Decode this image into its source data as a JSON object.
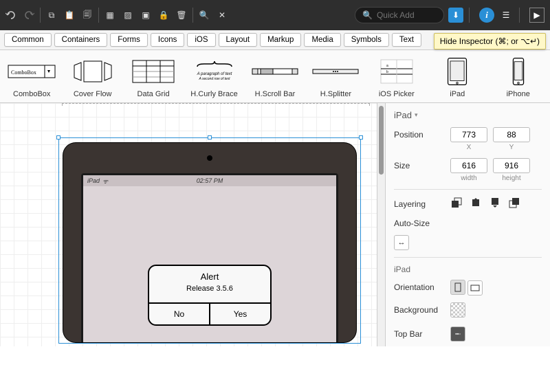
{
  "toolbar": {
    "search_placeholder": "Quick Add"
  },
  "tabs": [
    "Common",
    "Containers",
    "Forms",
    "Icons",
    "iOS",
    "Layout",
    "Markup",
    "Media",
    "Symbols",
    "Text"
  ],
  "shelf": [
    {
      "label": "ComboBox"
    },
    {
      "label": "Cover Flow"
    },
    {
      "label": "Data Grid"
    },
    {
      "label": "H.Curly Brace"
    },
    {
      "label": "H.Scroll Bar"
    },
    {
      "label": "H.Splitter"
    },
    {
      "label": "iOS Picker"
    },
    {
      "label": "iPad"
    },
    {
      "label": "iPhone"
    }
  ],
  "tooltip": "Hide Inspector (⌘; or ⌥↵)",
  "canvas": {
    "statusbar": {
      "device": "iPad",
      "time": "02:57 PM"
    },
    "alert": {
      "title": "Alert",
      "message": "Release 3.5.6",
      "no": "No",
      "yes": "Yes"
    }
  },
  "inspector": {
    "header": "iPad",
    "position": {
      "label": "Position",
      "x": "773",
      "y": "88",
      "x_sub": "X",
      "y_sub": "Y"
    },
    "size": {
      "label": "Size",
      "w": "616",
      "h": "916",
      "w_sub": "width",
      "h_sub": "height"
    },
    "layering_label": "Layering",
    "autosize_label": "Auto-Size",
    "device_section": "iPad",
    "orientation_label": "Orientation",
    "background_label": "Background",
    "topbar_label": "Top Bar"
  }
}
